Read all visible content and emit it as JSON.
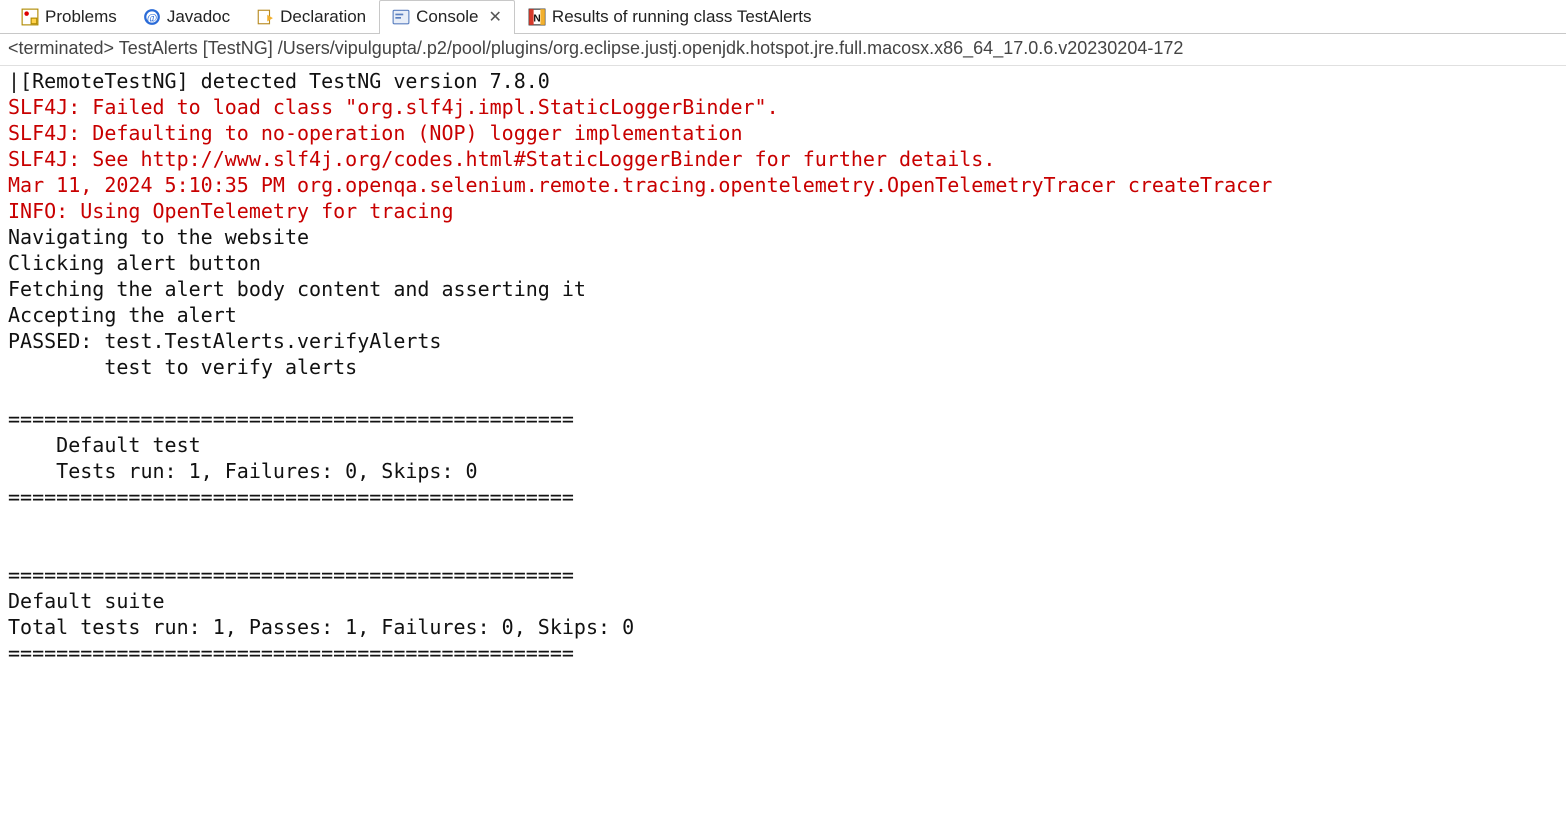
{
  "tabs": {
    "problems": "Problems",
    "javadoc": "Javadoc",
    "declaration": "Declaration",
    "console": "Console",
    "results": "Results of running class TestAlerts"
  },
  "subheader": "<terminated> TestAlerts [TestNG] /Users/vipulgupta/.p2/pool/plugins/org.eclipse.justj.openjdk.hotspot.jre.full.macosx.x86_64_17.0.6.v20230204-172",
  "console_lines": [
    {
      "t": "|[RemoteTestNG] detected TestNG version 7.8.0",
      "c": "out"
    },
    {
      "t": "SLF4J: Failed to load class \"org.slf4j.impl.StaticLoggerBinder\".",
      "c": "err"
    },
    {
      "t": "SLF4J: Defaulting to no-operation (NOP) logger implementation",
      "c": "err"
    },
    {
      "t": "SLF4J: See http://www.slf4j.org/codes.html#StaticLoggerBinder for further details.",
      "c": "err"
    },
    {
      "t": "Mar 11, 2024 5:10:35 PM org.openqa.selenium.remote.tracing.opentelemetry.OpenTelemetryTracer createTracer",
      "c": "err"
    },
    {
      "t": "INFO: Using OpenTelemetry for tracing",
      "c": "err"
    },
    {
      "t": "Navigating to the website",
      "c": "out"
    },
    {
      "t": "Clicking alert button",
      "c": "out"
    },
    {
      "t": "Fetching the alert body content and asserting it",
      "c": "out"
    },
    {
      "t": "Accepting the alert",
      "c": "out"
    },
    {
      "t": "PASSED: test.TestAlerts.verifyAlerts",
      "c": "out"
    },
    {
      "t": "        test to verify alerts",
      "c": "out"
    },
    {
      "t": "",
      "c": "out"
    },
    {
      "t": "===============================================",
      "c": "out"
    },
    {
      "t": "    Default test",
      "c": "out"
    },
    {
      "t": "    Tests run: 1, Failures: 0, Skips: 0",
      "c": "out"
    },
    {
      "t": "===============================================",
      "c": "out"
    },
    {
      "t": "",
      "c": "out"
    },
    {
      "t": "",
      "c": "out"
    },
    {
      "t": "===============================================",
      "c": "out"
    },
    {
      "t": "Default suite",
      "c": "out"
    },
    {
      "t": "Total tests run: 1, Passes: 1, Failures: 0, Skips: 0",
      "c": "out"
    },
    {
      "t": "===============================================",
      "c": "out"
    }
  ]
}
